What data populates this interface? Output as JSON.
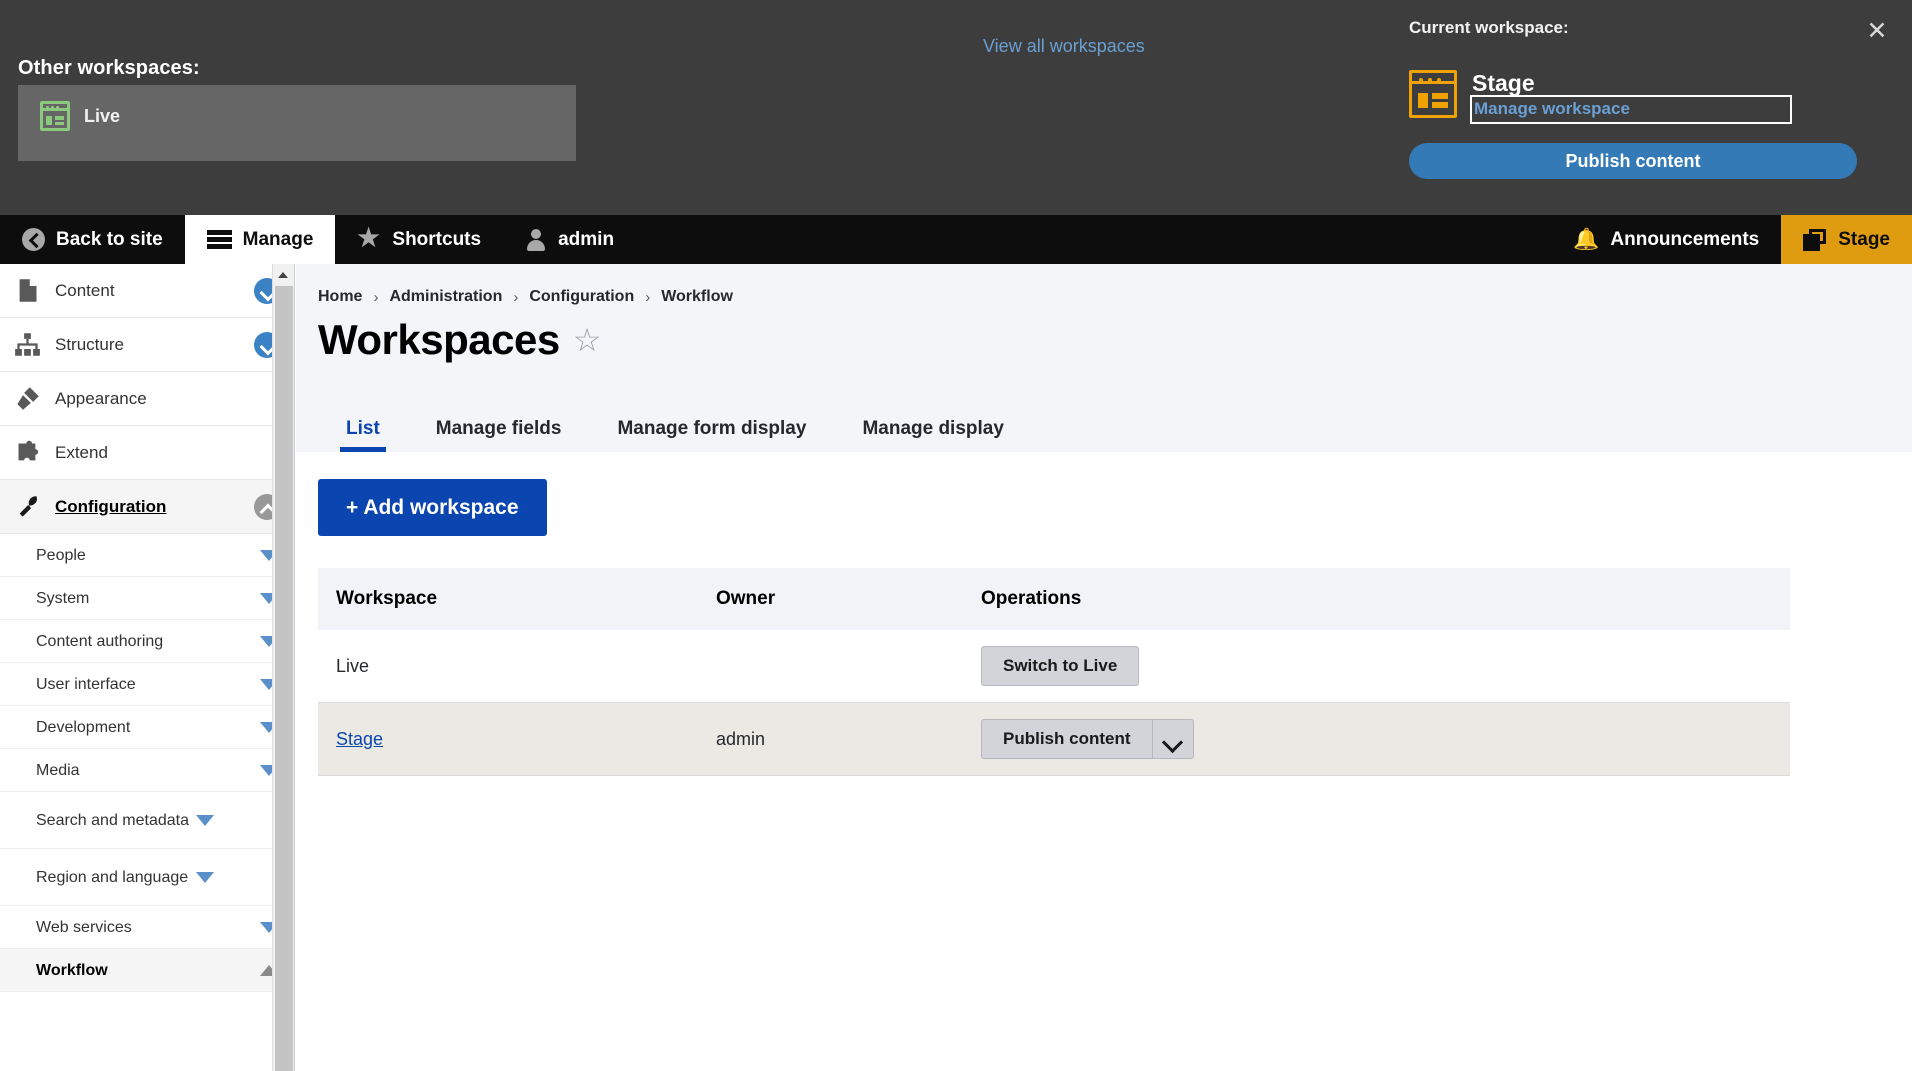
{
  "workspace_panel": {
    "close_icon": "close-icon",
    "other_label": "Other workspaces:",
    "other_workspaces": [
      {
        "name": "Live",
        "icon": "workspace-icon",
        "color": "#8bc97f"
      }
    ],
    "view_all_label": "View all workspaces",
    "current_label": "Current workspace:",
    "current_name": "Stage",
    "current_icon_color": "#f0a202",
    "manage_link_label": "Manage workspace",
    "publish_button_label": "Publish content",
    "publish_button_color": "#337ab7",
    "panel_bg": "#3d3d3d"
  },
  "toolbar": {
    "back_to_site": "Back to site",
    "manage": "Manage",
    "shortcuts": "Shortcuts",
    "account": "admin",
    "announcements": "Announcements",
    "stage": "Stage",
    "stage_bg": "#e09c10"
  },
  "sidebar": {
    "items": [
      {
        "label": "Content",
        "icon": "document-icon",
        "toggle": "chevron-down-circle-icon"
      },
      {
        "label": "Structure",
        "icon": "sitemap-icon",
        "toggle": "chevron-down-circle-icon"
      },
      {
        "label": "Appearance",
        "icon": "paintbrush-icon",
        "toggle": "none"
      },
      {
        "label": "Extend",
        "icon": "puzzle-piece-icon",
        "toggle": "none"
      },
      {
        "label": "Configuration",
        "icon": "wrench-icon",
        "toggle": "chevron-up-circle-icon",
        "selected": true
      }
    ],
    "sub_items": [
      {
        "label": "People",
        "toggle": "triangle-down-icon"
      },
      {
        "label": "System",
        "toggle": "triangle-down-icon"
      },
      {
        "label": "Content authoring",
        "toggle": "triangle-down-icon"
      },
      {
        "label": "User interface",
        "toggle": "triangle-down-icon"
      },
      {
        "label": "Development",
        "toggle": "triangle-down-icon"
      },
      {
        "label": "Media",
        "toggle": "triangle-down-icon"
      },
      {
        "label": "Search and metadata",
        "toggle": "triangle-down-icon",
        "two_line": true
      },
      {
        "label": "Region and language",
        "toggle": "triangle-down-icon",
        "two_line": true
      },
      {
        "label": "Web services",
        "toggle": "triangle-down-icon"
      },
      {
        "label": "Workflow",
        "toggle": "triangle-up-icon",
        "selected": true
      }
    ]
  },
  "main": {
    "breadcrumb": [
      "Home",
      "Administration",
      "Configuration",
      "Workflow"
    ],
    "breadcrumb_separator": "›",
    "page_title": "Workspaces",
    "favorite_icon": "star-outline-icon",
    "tabs": [
      {
        "label": "List",
        "active": true
      },
      {
        "label": "Manage fields",
        "active": false
      },
      {
        "label": "Manage form display",
        "active": false
      },
      {
        "label": "Manage display",
        "active": false
      }
    ],
    "add_button_label": "+ Add workspace",
    "table": {
      "columns": [
        "Workspace",
        "Owner",
        "Operations"
      ],
      "rows": [
        {
          "workspace": "Live",
          "workspace_is_link": false,
          "owner": "",
          "operation_label": "Switch to Live",
          "has_dropdown": false,
          "highlighted": false
        },
        {
          "workspace": "Stage",
          "workspace_is_link": true,
          "owner": "admin",
          "operation_label": "Publish content",
          "has_dropdown": true,
          "highlighted": true
        }
      ]
    }
  }
}
